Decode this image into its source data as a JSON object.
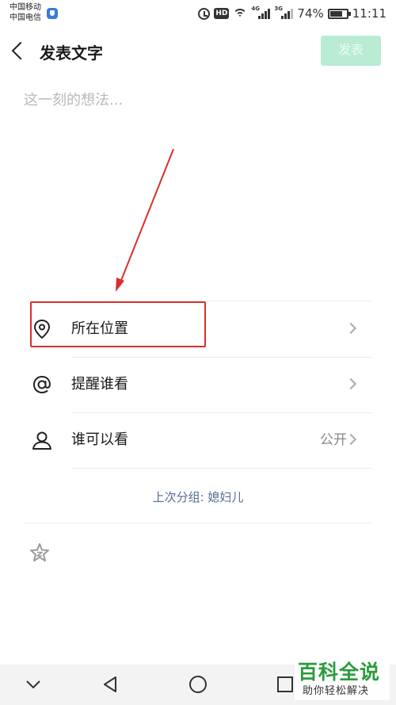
{
  "status_bar": {
    "carrier_1": "中国移动",
    "carrier_2": "中国电信",
    "hd_badge": "HD",
    "network_1": "4G",
    "network_2": "3G",
    "battery_percent": "74%",
    "battery_level": 0.74,
    "time": "11:11"
  },
  "header": {
    "title": "发表文字",
    "publish_label": "发表",
    "back_icon": "chevron-left-icon"
  },
  "composer": {
    "placeholder": "这一刻的想法...",
    "value": ""
  },
  "options": [
    {
      "label": "所在位置",
      "icon": "location-pin-icon",
      "value": ""
    },
    {
      "label": "提醒谁看",
      "icon": "at-icon",
      "value": ""
    },
    {
      "label": "谁可以看",
      "icon": "person-icon",
      "value": "公开"
    }
  ],
  "last_group": "上次分组: 媳妇儿",
  "nav_bar": {
    "buttons": [
      "chevron-down-icon",
      "back-triangle-icon",
      "home-circle-icon",
      "recents-square-icon"
    ]
  },
  "watermark": {
    "title": "百科全说",
    "subtitle": "助你轻松解决"
  },
  "colors": {
    "publish_disabled": "#b9ecd3",
    "highlight": "#d9302c",
    "link": "#576b95",
    "watermark_green": "#2a9c3a"
  }
}
